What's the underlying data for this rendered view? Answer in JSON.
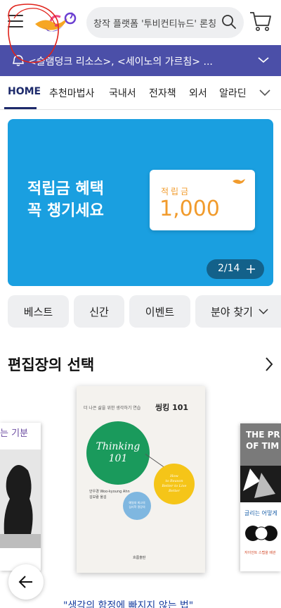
{
  "header": {
    "search_placeholder": "창작 플랫폼 '투비컨티뉴드' 론칭",
    "icons": [
      "hamburger-icon",
      "genie-lamp-logo",
      "search-icon",
      "cart-icon"
    ]
  },
  "notice": {
    "text": "<슬램덩크 리소스>, <세이노의 가르침> ...",
    "background": "#4b4fa8"
  },
  "tabs": [
    {
      "label": "HOME",
      "active": true
    },
    {
      "label": "추천마법사"
    },
    {
      "label": "국내서"
    },
    {
      "label": "전자책"
    },
    {
      "label": "외서"
    },
    {
      "label": "알라딘"
    }
  ],
  "promo": {
    "headline_line1": "적립금 혜택",
    "headline_line2": "꼭 챙기세요",
    "card_label": "적립금",
    "card_amount": "1,000",
    "pager": "2/14",
    "background": "#1a9fe0"
  },
  "quick_buttons": {
    "best": "베스트",
    "new": "신간",
    "event": "이벤트",
    "category": "분야 찾기"
  },
  "section": {
    "title": "편집장의 선택"
  },
  "books": {
    "left_title_partial": "는 기분",
    "main": {
      "tagline": "더 나은 삶을 위한 생각하기 연습",
      "title_kr": "씽킹 101",
      "title_en_1": "Thinking",
      "title_en_2": "101",
      "subtitle_en_1": "How",
      "subtitle_en_2": "to Reason",
      "subtitle_en_3": "Better to Live",
      "subtitle_en_4": "Better",
      "author_1": "안우경 Woo-kyoung Ahn",
      "author_2": "김보람 옮김",
      "blue_text_1": "예일대 최고의",
      "blue_text_2": "심리학 명강의",
      "publisher": "흐름출판"
    },
    "right": {
      "title_1": "THE PR",
      "title_2": "OF TIM",
      "caption": "글리는 어떻게",
      "subcaption": "자이언트 스텝을 배관"
    },
    "quote": "\"생각의 함정에 빠지지 않는 법\""
  }
}
